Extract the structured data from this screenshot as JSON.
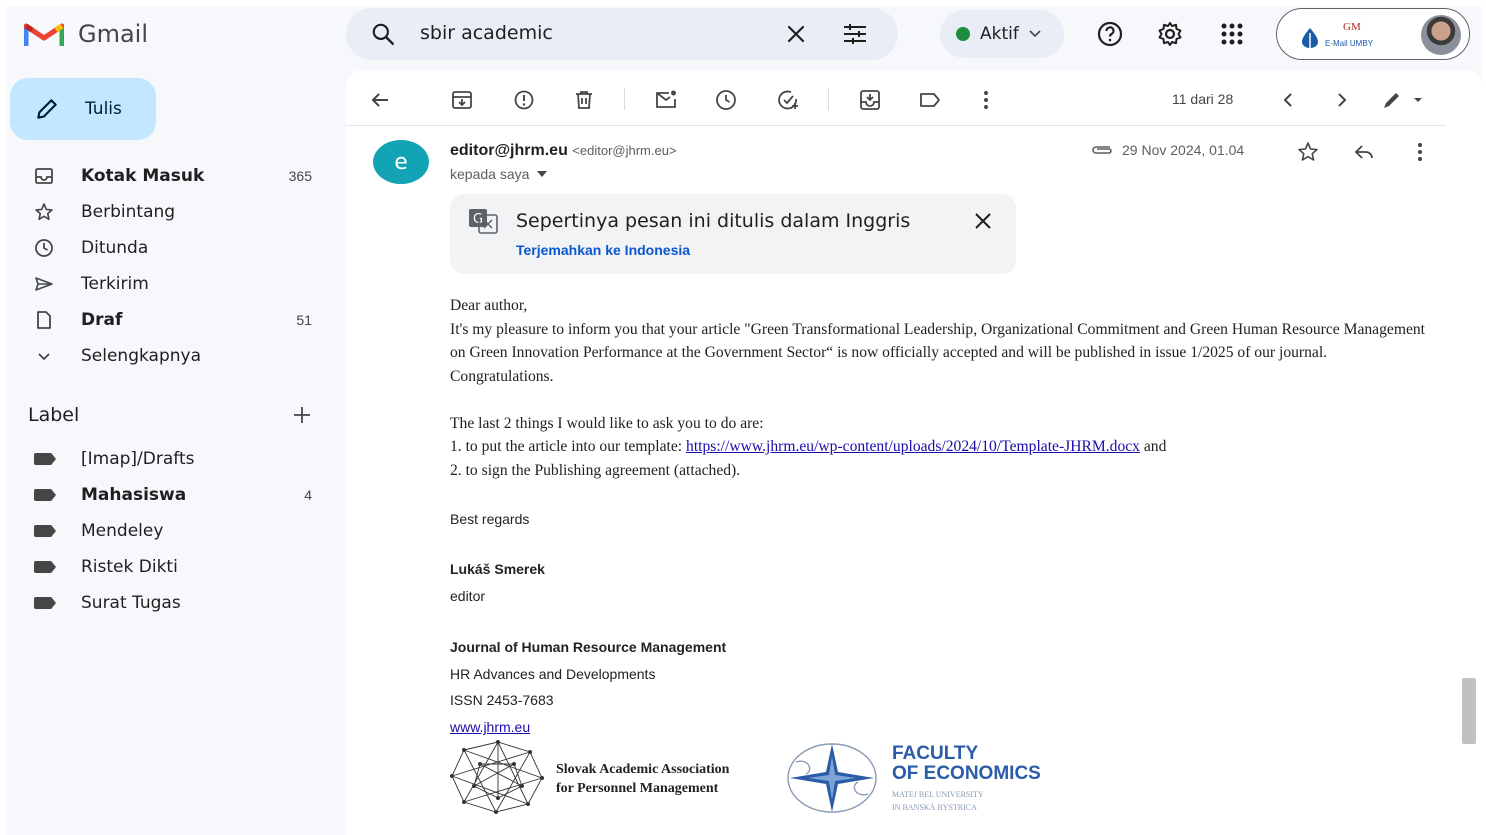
{
  "app": {
    "name": "Gmail"
  },
  "search": {
    "query": "sbir academic"
  },
  "status": {
    "label": "Aktif",
    "color": "#1e8e3e"
  },
  "account": {
    "logo_top": "GM",
    "logo_bottom": "E-Mail UMBY"
  },
  "sidebar": {
    "compose_label": "Tulis",
    "items": [
      {
        "label": "Kotak Masuk",
        "count": "365",
        "bold": true,
        "icon": "inbox-icon"
      },
      {
        "label": "Berbintang",
        "count": "",
        "bold": false,
        "icon": "star-icon"
      },
      {
        "label": "Ditunda",
        "count": "",
        "bold": false,
        "icon": "clock-icon"
      },
      {
        "label": "Terkirim",
        "count": "",
        "bold": false,
        "icon": "send-icon"
      },
      {
        "label": "Draf",
        "count": "51",
        "bold": true,
        "icon": "draft-icon"
      },
      {
        "label": "Selengkapnya",
        "count": "",
        "bold": false,
        "icon": "chevron-down-icon"
      }
    ],
    "labels_heading": "Label",
    "labels": [
      {
        "name": "[Imap]/Drafts",
        "count": "",
        "bold": false
      },
      {
        "name": "Mahasiswa",
        "count": "4",
        "bold": true
      },
      {
        "name": "Mendeley",
        "count": "",
        "bold": false
      },
      {
        "name": "Ristek Dikti",
        "count": "",
        "bold": false
      },
      {
        "name": "Surat Tugas",
        "count": "",
        "bold": false
      }
    ]
  },
  "toolbar": {
    "pager": "11 dari 28"
  },
  "message": {
    "avatar_letter": "e",
    "sender_name": "editor@jhrm.eu",
    "sender_address": "<editor@jhrm.eu>",
    "to": "kepada saya",
    "date": "29 Nov 2024, 01.04",
    "translate": {
      "title": "Sepertinya pesan ini ditulis dalam Inggris",
      "link": "Terjemahkan ke Indonesia"
    },
    "greeting": "Dear author,",
    "paragraph1": "It's my pleasure to inform you that your article \"Green Transformational Leadership, Organizational Commitment and Green Human Resource Management on Green Innovation Performance at the Government Sector“ is now officially accepted and will be published in issue 1/2025 of our journal. Congratulations.",
    "ask_intro": "The last 2 things I would like to ask you to do are:",
    "step1_prefix": "1. to put the article into our template: ",
    "step1_link": "https://www.jhrm.eu/wp-content/uploads/2024/10/Template-JHRM.docx",
    "step1_suffix": " and",
    "step2": "2. to sign the Publishing agreement (attached).",
    "closing": "Best regards",
    "signature_name": "Lukáš Smerek",
    "signature_role": "editor",
    "journal_name": "Journal of Human Resource Management",
    "journal_sub": "HR Advances and Developments",
    "issn": "ISSN 2453-7683",
    "website": "www.jhrm.eu",
    "logo1_line1": "Slovak Academic Association",
    "logo1_line2": "for Personnel Management",
    "logo2_line1": "FACULTY",
    "logo2_line2": "OF ECONOMICS",
    "logo2_sub1": "MATEJ BEL UNIVERSITY",
    "logo2_sub2": "IN BANSKÁ BYSTRICA"
  }
}
